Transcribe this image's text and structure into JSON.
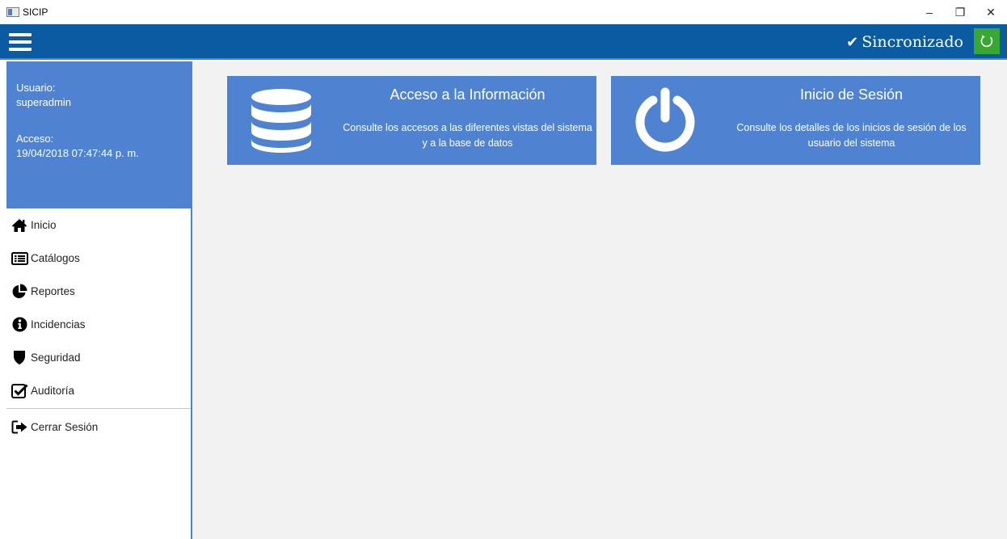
{
  "window": {
    "title": "SICIP",
    "minimize": "–",
    "maximize": "❐",
    "close": "✕"
  },
  "header": {
    "sync_check": "✔",
    "sync_label": "Sincronizado"
  },
  "user": {
    "usuario_label": "Usuario:",
    "usuario_value": "superadmin",
    "acceso_label": "Acceso:",
    "acceso_value": "19/04/2018 07:47:44 p. m."
  },
  "nav": {
    "items": [
      {
        "label": "Inicio",
        "icon": "home-icon"
      },
      {
        "label": "Catálogos",
        "icon": "list-icon"
      },
      {
        "label": "Reportes",
        "icon": "pie-chart-icon"
      },
      {
        "label": "Incidencias",
        "icon": "info-icon"
      },
      {
        "label": "Seguridad",
        "icon": "shield-icon"
      },
      {
        "label": "Auditoría",
        "icon": "checkbox-icon"
      }
    ],
    "logout": {
      "label": "Cerrar Sesión",
      "icon": "sign-out-icon"
    }
  },
  "cards": [
    {
      "title": "Acceso a la Información",
      "description": "Consulte los accesos a las diferentes vistas del sistema y a la base de datos",
      "icon": "database-icon"
    },
    {
      "title": "Inicio de Sesión",
      "description": "Consulte los detalles de los inicios de sesión de los usuario del sistema",
      "icon": "power-icon"
    }
  ],
  "colors": {
    "header_bg": "#0b5ba3",
    "panel_blue": "#4f83d2",
    "sync_green": "#38a833",
    "main_bg": "#f2f2f2"
  }
}
